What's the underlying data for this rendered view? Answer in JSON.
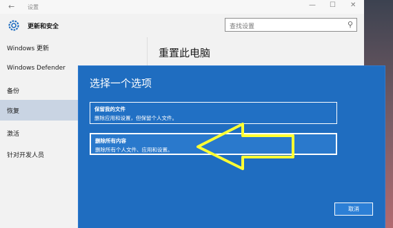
{
  "window": {
    "title": "设置",
    "back_glyph": "←",
    "minimize_glyph": "—",
    "maximize_glyph": "☐",
    "close_glyph": "✕"
  },
  "header": {
    "section_title": "更新和安全",
    "icon": "gear-icon"
  },
  "search": {
    "placeholder": "查找设置",
    "icon": "search-icon",
    "icon_glyph": "⚲"
  },
  "sidebar": {
    "items": [
      {
        "label": "Windows 更新",
        "active": false
      },
      {
        "label": "Windows Defender",
        "active": false
      },
      {
        "label": "备份",
        "active": false
      },
      {
        "label": "恢复",
        "active": true
      },
      {
        "label": "激活",
        "active": false
      },
      {
        "label": "针对开发人员",
        "active": false
      }
    ]
  },
  "main": {
    "title": "重置此电脑"
  },
  "dialog": {
    "title": "选择一个选项",
    "options": [
      {
        "title": "保留我的文件",
        "description": "删除应用和设置，但保留个人文件。",
        "selected": false
      },
      {
        "title": "删除所有内容",
        "description": "删除所有个人文件、应用和设置。",
        "selected": true
      }
    ],
    "cancel_label": "取消"
  },
  "annotation": {
    "type": "arrow",
    "color": "#ffff33"
  },
  "colors": {
    "accent": "#1f6dc0",
    "sidebar_active": "#c9d4e3",
    "annotation_arrow": "#ffff33"
  }
}
